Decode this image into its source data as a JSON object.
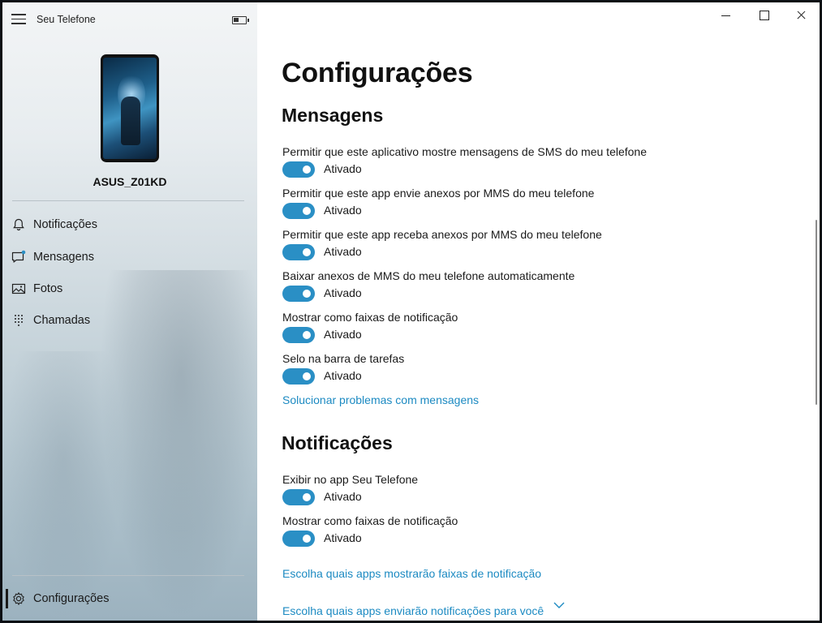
{
  "app": {
    "title": "Seu Telefone"
  },
  "device": {
    "name": "ASUS_Z01KD"
  },
  "nav": {
    "notifications": "Notificações",
    "messages": "Mensagens",
    "photos": "Fotos",
    "calls": "Chamadas",
    "settings": "Configurações"
  },
  "page": {
    "title": "Configurações"
  },
  "messages_section": {
    "title": "Mensagens",
    "settings": [
      {
        "label": "Permitir que este aplicativo mostre mensagens de SMS do meu telefone",
        "state": "Ativado"
      },
      {
        "label": "Permitir que este app envie anexos por MMS do meu telefone",
        "state": "Ativado"
      },
      {
        "label": "Permitir que este app receba anexos por MMS do meu telefone",
        "state": "Ativado"
      },
      {
        "label": "Baixar anexos de MMS do meu telefone automaticamente",
        "state": "Ativado"
      },
      {
        "label": "Mostrar como faixas de notificação",
        "state": "Ativado"
      },
      {
        "label": "Selo na barra de tarefas",
        "state": "Ativado"
      }
    ],
    "troubleshoot_link": "Solucionar problemas com mensagens"
  },
  "notifications_section": {
    "title": "Notificações",
    "settings": [
      {
        "label": "Exibir no app Seu Telefone",
        "state": "Ativado"
      },
      {
        "label": "Mostrar como faixas de notificação",
        "state": "Ativado"
      }
    ],
    "banner_apps_link": "Escolha quais apps mostrarão faixas de notificação",
    "notify_apps_link": "Escolha quais apps enviarão notificações para você"
  },
  "colors": {
    "accent": "#2a8fc5",
    "link": "#1c8ac2"
  },
  "icons": {
    "menu": "hamburger-icon",
    "battery": "battery-icon",
    "notifications": "bell-icon",
    "messages": "chat-icon",
    "photos": "image-icon",
    "calls": "dialpad-icon",
    "settings": "gear-icon",
    "expand": "chevron-down-icon"
  }
}
